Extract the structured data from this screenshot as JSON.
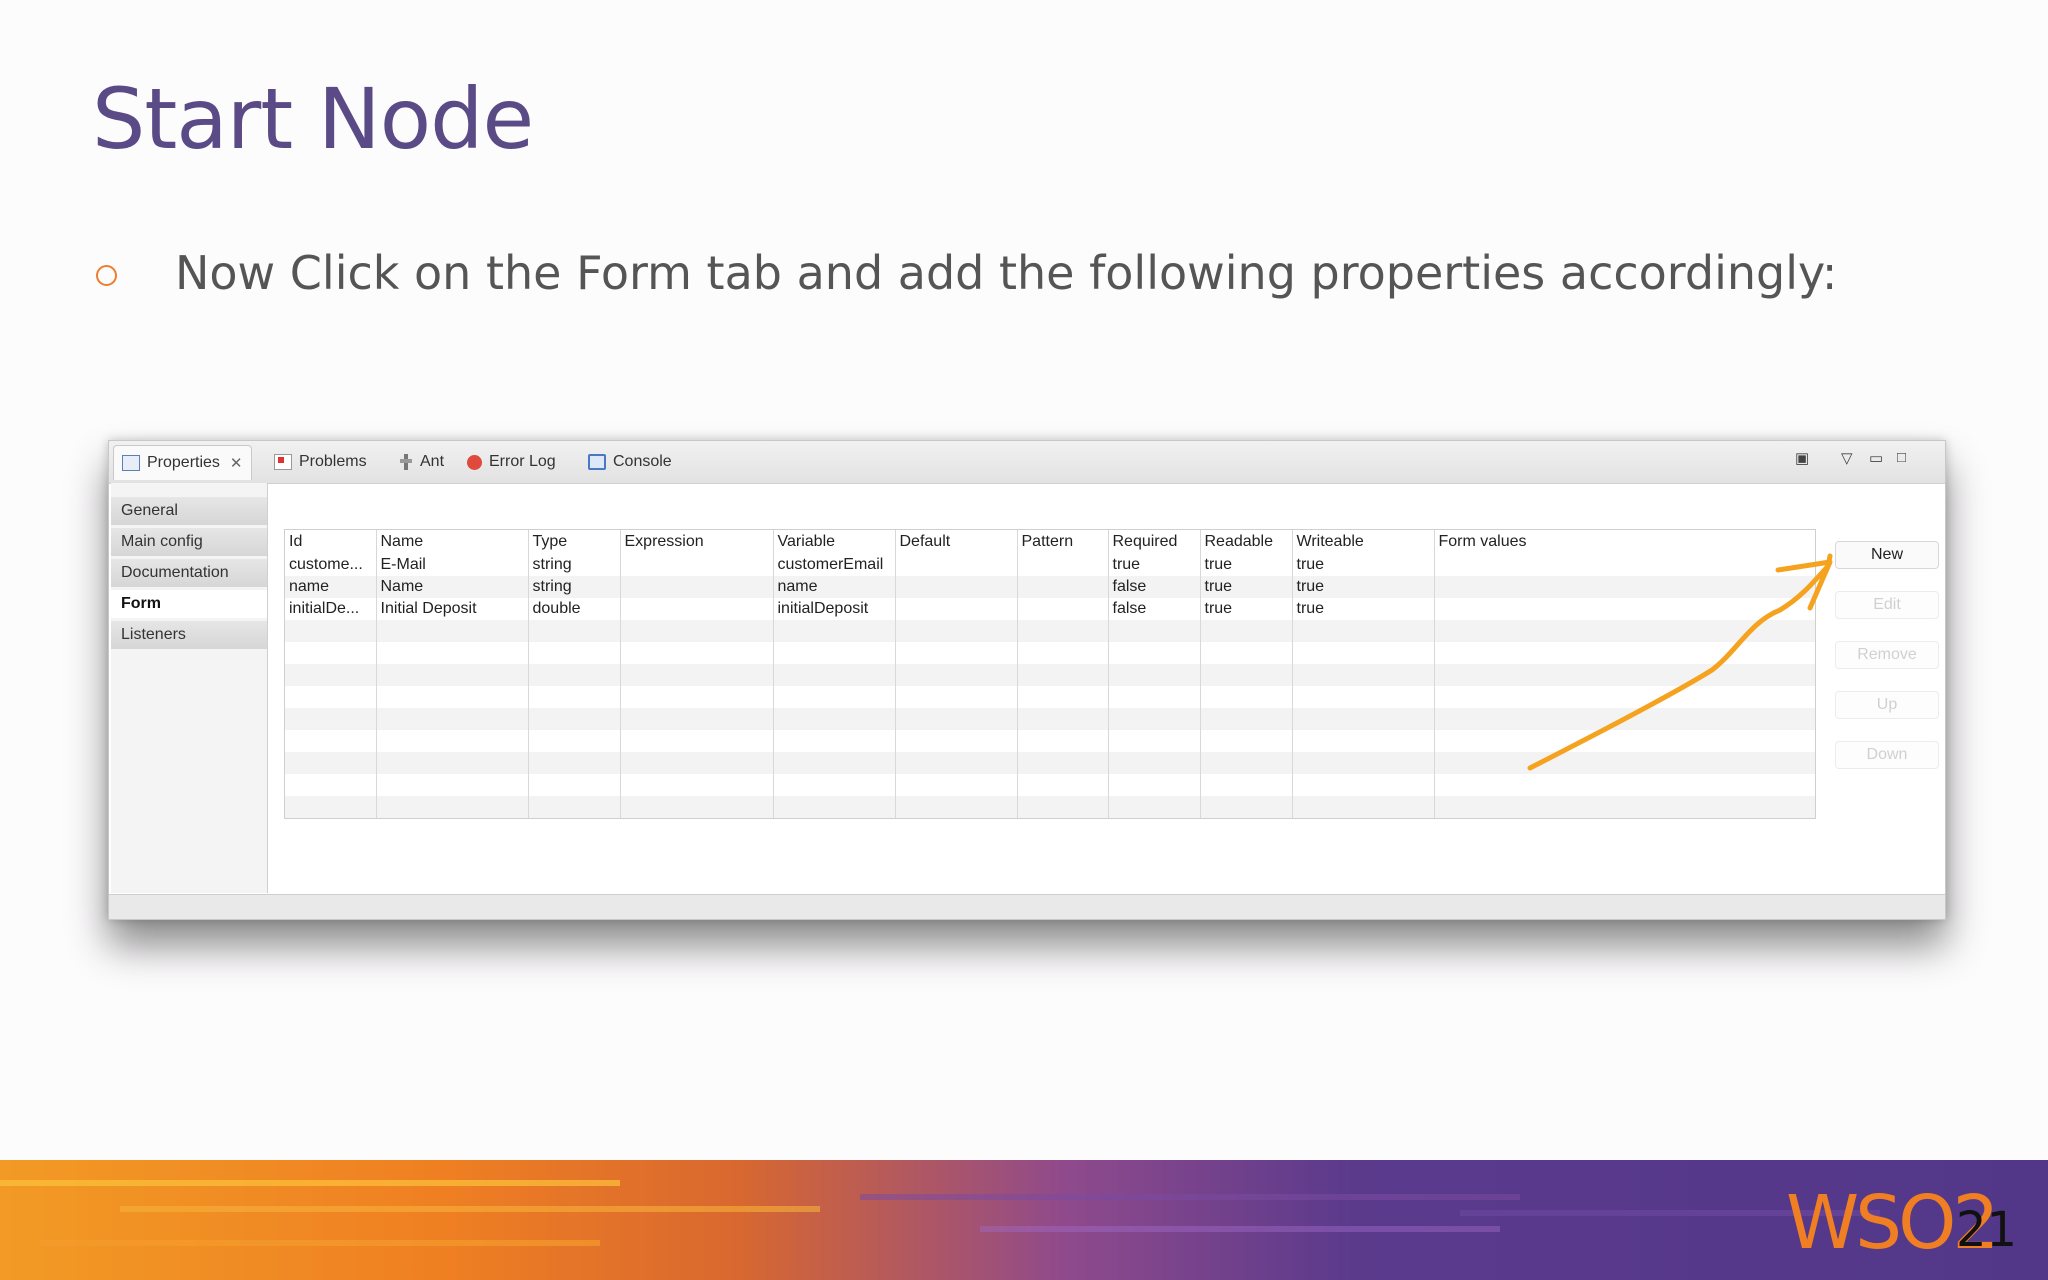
{
  "slide": {
    "title": "Start Node",
    "bullet": "Now Click on the Form tab and add the following properties accordingly:",
    "page_number": "21",
    "logo_text": "WSO2"
  },
  "tabs": [
    {
      "label": "Properties",
      "icon": "properties-icon",
      "active": true
    },
    {
      "label": "Problems",
      "icon": "problems-icon"
    },
    {
      "label": "Ant",
      "icon": "ant-icon"
    },
    {
      "label": "Error Log",
      "icon": "error-log-icon"
    },
    {
      "label": "Console",
      "icon": "console-icon"
    }
  ],
  "sidebar": {
    "items": [
      "General",
      "Main config",
      "Documentation",
      "Form",
      "Listeners"
    ],
    "selected": "Form"
  },
  "table": {
    "columns": [
      "Id",
      "Name",
      "Type",
      "Expression",
      "Variable",
      "Default",
      "Pattern",
      "Required",
      "Readable",
      "Writeable",
      "Form values"
    ],
    "rows": [
      [
        "custome...",
        "E-Mail",
        "string",
        "",
        "customerEmail",
        "",
        "",
        "true",
        "true",
        "true",
        ""
      ],
      [
        "name",
        "Name",
        "string",
        "",
        "name",
        "",
        "",
        "false",
        "true",
        "true",
        ""
      ],
      [
        "initialDe...",
        "Initial Deposit",
        "double",
        "",
        "initialDeposit",
        "",
        "",
        "false",
        "true",
        "true",
        ""
      ]
    ]
  },
  "buttons": {
    "new": "New",
    "edit": "Edit",
    "remove": "Remove",
    "up": "Up",
    "down": "Down"
  },
  "colors": {
    "title": "#5a4a85",
    "bullet": "#ef7d2f",
    "annotation_arrow": "#f5a21e"
  }
}
